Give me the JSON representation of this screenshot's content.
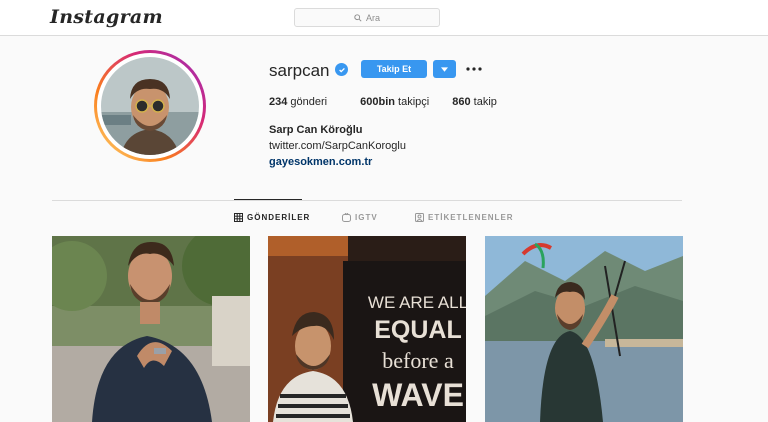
{
  "header": {
    "logo": "Instagram",
    "search_placeholder": "Ara"
  },
  "profile": {
    "username": "sarpcan",
    "verified": true,
    "follow_label": "Takip Et",
    "stats": {
      "posts_count": "234",
      "posts_label": "gönderi",
      "followers_count": "600bin",
      "followers_label": "takipçi",
      "following_count": "860",
      "following_label": "takip"
    },
    "full_name": "Sarp Can Köroğlu",
    "bio": "twitter.com/SarpCanKoroglu",
    "website": "gayesokmen.com.tr"
  },
  "tabs": [
    {
      "label": "GÖNDERİLER",
      "active": true
    },
    {
      "label": "IGTV",
      "active": false
    },
    {
      "label": "ETİKETLENENLER",
      "active": false
    }
  ],
  "posts": [
    {
      "icon": "photo-man-street"
    },
    {
      "icon": "photo-man-bar",
      "poster_lines": [
        "WE ARE ALL",
        "EQUAL",
        "before a",
        "WAVE"
      ]
    },
    {
      "icon": "photo-man-kite"
    }
  ],
  "colors": {
    "accent": "#3897f0",
    "link": "#003569",
    "border": "#dbdbdb"
  }
}
